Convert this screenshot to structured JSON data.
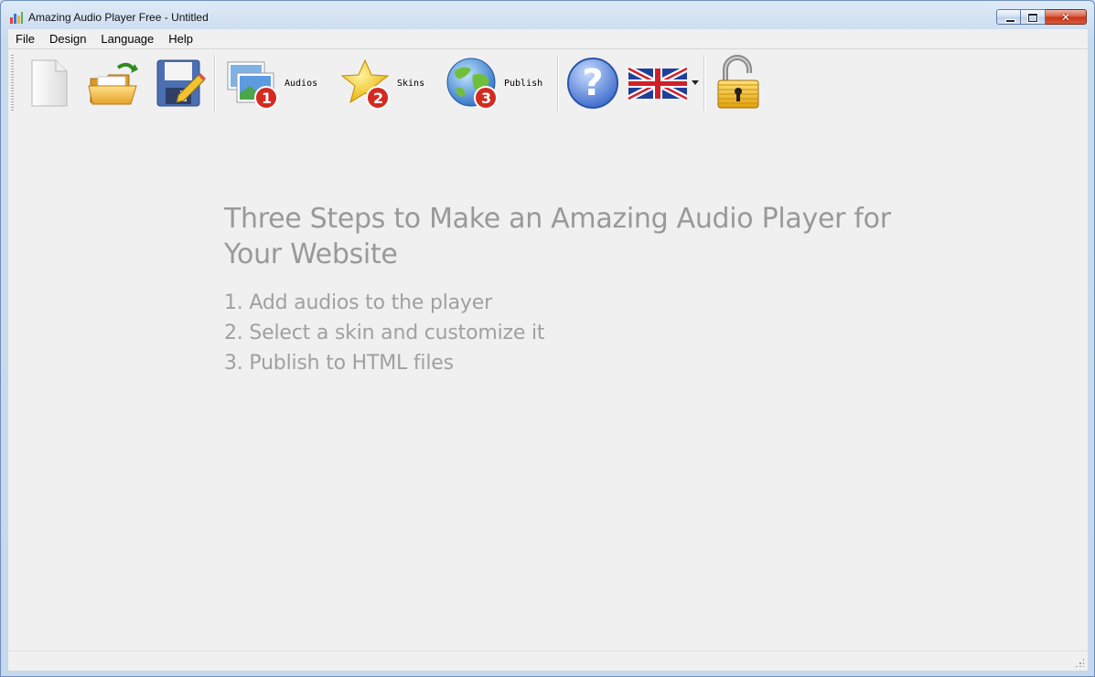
{
  "window": {
    "title": "Amazing Audio Player Free - Untitled",
    "close_glyph": "✕"
  },
  "menu": [
    "File",
    "Design",
    "Language",
    "Help"
  ],
  "toolbar": {
    "buttons": [
      {
        "icon": "new-document-icon"
      },
      {
        "icon": "open-folder-icon"
      },
      {
        "icon": "save-icon"
      },
      {
        "icon": "audios-icon",
        "label": "Audios",
        "badge": "1"
      },
      {
        "icon": "skins-star-icon",
        "label": "Skins",
        "badge": "2"
      },
      {
        "icon": "publish-globe-icon",
        "label": "Publish",
        "badge": "3"
      },
      {
        "icon": "help-icon",
        "glyph": "?"
      },
      {
        "icon": "uk-flag-icon"
      },
      {
        "icon": "unlock-padlock-icon"
      }
    ]
  },
  "content": {
    "headline": "Three Steps to Make an Amazing Audio Player for Your Website",
    "steps": [
      "1. Add audios to the player",
      "2. Select a skin and customize it",
      "3. Publish to HTML files"
    ]
  },
  "colors": {
    "frame": "#c6d8ee",
    "panel": "#f0f0f0",
    "text_muted": "#999999",
    "badge_red": "#d42a1f"
  }
}
